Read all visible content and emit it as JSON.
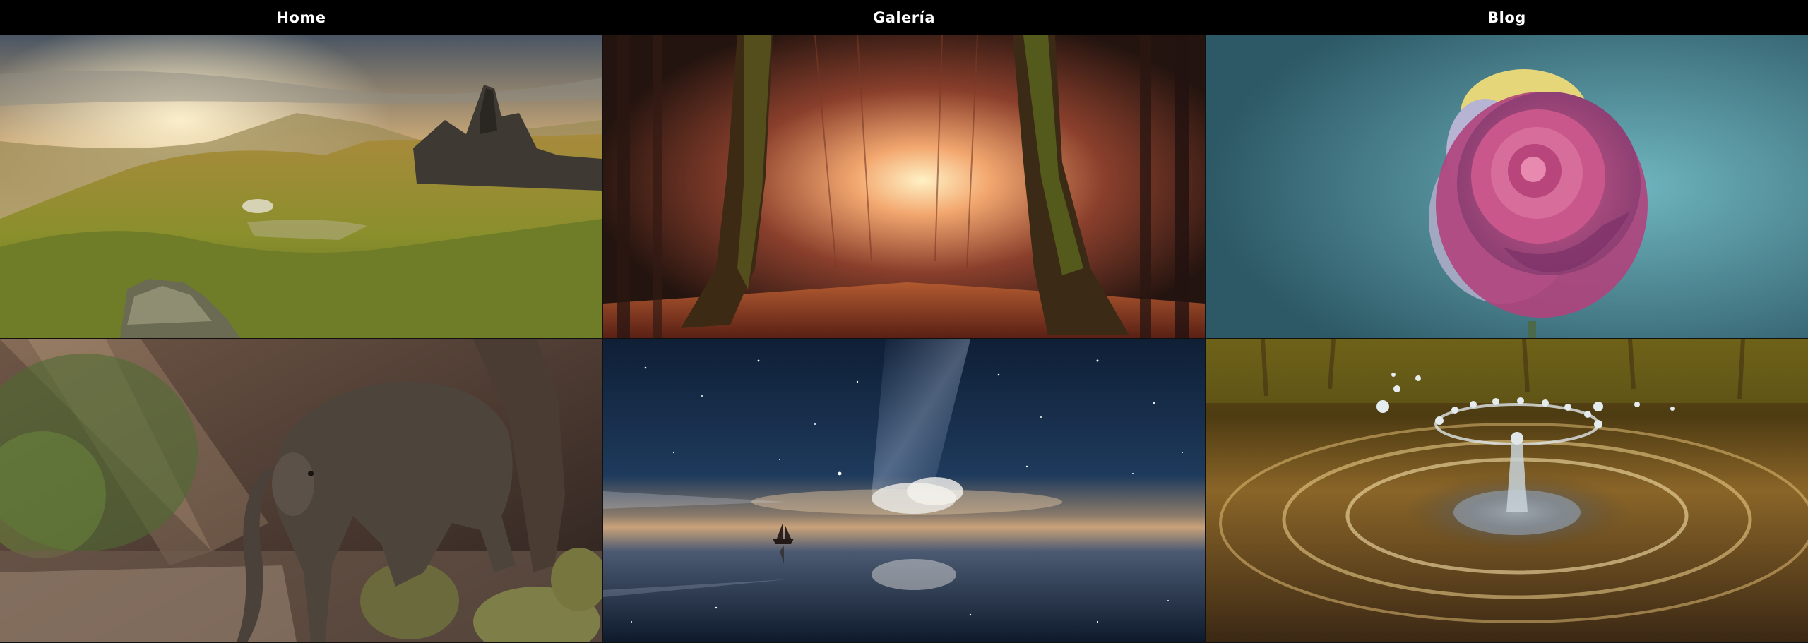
{
  "nav": {
    "items": [
      {
        "label": "Home"
      },
      {
        "label": "Galería"
      },
      {
        "label": "Blog"
      }
    ]
  },
  "gallery": {
    "tiles": [
      {
        "subject": "mountain-landscape"
      },
      {
        "subject": "autumn-forest-path"
      },
      {
        "subject": "dewy-rose"
      },
      {
        "subject": "baby-elephant"
      },
      {
        "subject": "starry-sea-sailboat"
      },
      {
        "subject": "water-droplet-splash"
      }
    ]
  },
  "colors": {
    "nav_background": "#000000",
    "nav_text": "#ffffff"
  }
}
